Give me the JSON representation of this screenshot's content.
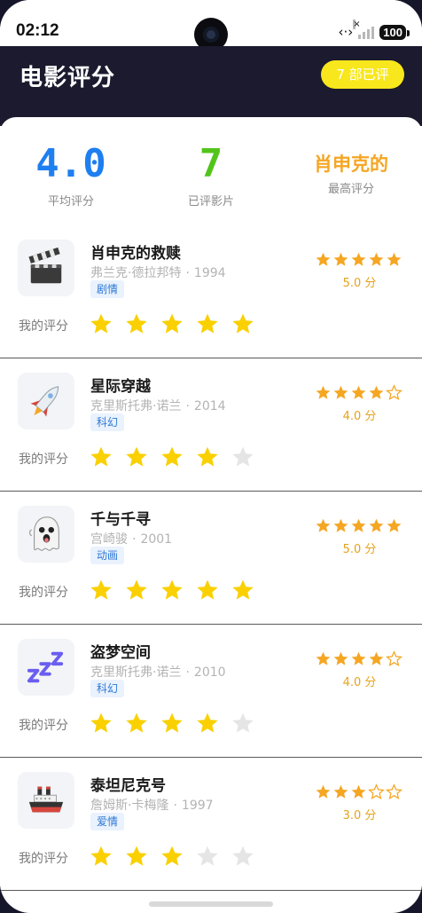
{
  "status_bar": {
    "time": "02:12",
    "icons": [
      "code-icon",
      "signal-icon",
      "battery-icon"
    ],
    "battery": "100"
  },
  "header": {
    "title": "电影评分",
    "badge": "7 部已评"
  },
  "summary": {
    "average": {
      "value": "4.0",
      "label": "平均评分",
      "color": "#1e7ff0"
    },
    "rated": {
      "value": "7",
      "label": "已评影片",
      "color": "#52c41a"
    },
    "top": {
      "value": "肖申克的",
      "label": "最高评分",
      "color": "#f5a623"
    }
  },
  "colors": {
    "star_filled": "#f5a623",
    "my_star_filled": "#fad000",
    "star_empty": "#e5e5e5",
    "genre_bg": "#e9f2fd",
    "genre_text": "#2f78d6"
  },
  "my_rating_label": "我的评分",
  "movies": [
    {
      "title": "肖申克的救赎",
      "director": "弗兰克·德拉邦特",
      "dot": "·",
      "year": "1994",
      "genre": "剧情",
      "avg_stars": 5,
      "score": "5.0 分",
      "my_rating": 5,
      "icon": "clapperboard-icon"
    },
    {
      "title": "星际穿越",
      "director": "克里斯托弗·诺兰",
      "dot": "·",
      "year": "2014",
      "genre": "科幻",
      "avg_stars": 4,
      "score": "4.0 分",
      "my_rating": 4,
      "icon": "rocket-icon"
    },
    {
      "title": "千与千寻",
      "director": "宫崎骏",
      "dot": "·",
      "year": "2001",
      "genre": "动画",
      "avg_stars": 5,
      "score": "5.0 分",
      "my_rating": 5,
      "icon": "ghost-icon"
    },
    {
      "title": "盗梦空间",
      "director": "克里斯托弗·诺兰",
      "dot": "·",
      "year": "2010",
      "genre": "科幻",
      "avg_stars": 4,
      "score": "4.0 分",
      "my_rating": 4,
      "icon": "zzz-icon"
    },
    {
      "title": "泰坦尼克号",
      "director": "詹姆斯·卡梅隆",
      "dot": "·",
      "year": "1997",
      "genre": "爱情",
      "avg_stars": 3,
      "score": "3.0 分",
      "my_rating": 3,
      "icon": "ship-icon"
    }
  ]
}
